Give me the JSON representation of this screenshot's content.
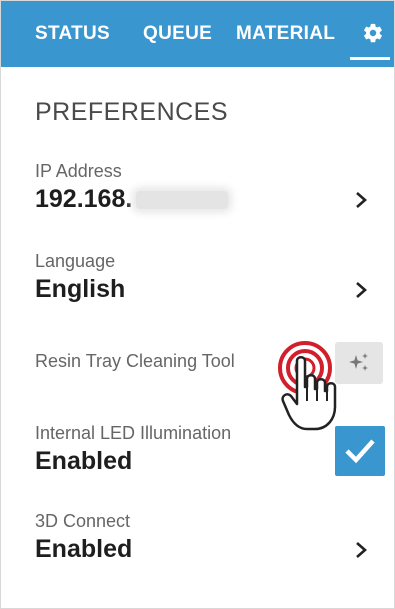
{
  "tabs": {
    "status": "STATUS",
    "queue": "QUEUE",
    "material": "MATERIAL",
    "settings_icon": "gear-icon",
    "active": "settings"
  },
  "preferences": {
    "title": "PREFERENCES",
    "ip_address": {
      "label": "IP Address",
      "value": "192.168."
    },
    "language": {
      "label": "Language",
      "value": "English"
    },
    "resin_tray": {
      "label": "Resin Tray Cleaning Tool",
      "icon": "sparkle-icon"
    },
    "led": {
      "label": "Internal LED Illumination",
      "value": "Enabled",
      "checked": true
    },
    "connect": {
      "label": "3D Connect",
      "value": "Enabled"
    }
  },
  "colors": {
    "accent": "#3a96cf",
    "tap_indicator": "#d21f2c"
  }
}
